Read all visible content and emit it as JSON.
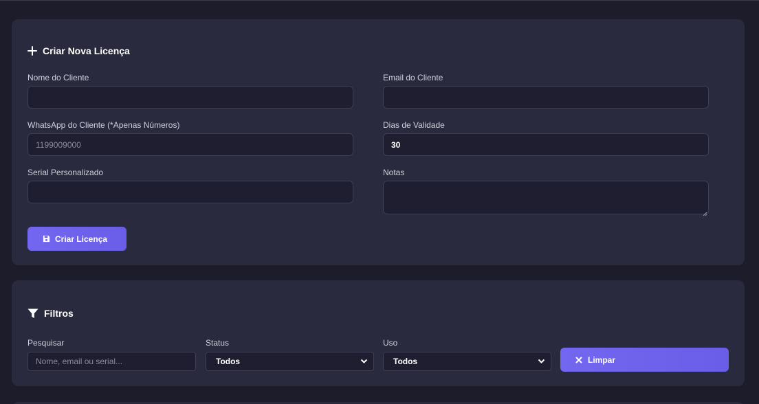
{
  "create": {
    "title": "Criar Nova Licença",
    "fields": {
      "name": {
        "label": "Nome do Cliente",
        "value": "",
        "placeholder": ""
      },
      "email": {
        "label": "Email do Cliente",
        "value": "",
        "placeholder": ""
      },
      "whatsapp": {
        "label": "WhatsApp do Cliente (*Apenas Números)",
        "value": "",
        "placeholder": "1199009000"
      },
      "days": {
        "label": "Dias de Validade",
        "value": "30",
        "placeholder": ""
      },
      "serial": {
        "label": "Serial Personalizado",
        "value": "",
        "placeholder": ""
      },
      "notes": {
        "label": "Notas",
        "value": "",
        "placeholder": ""
      }
    },
    "submit_label": "Criar Licença"
  },
  "filters": {
    "title": "Filtros",
    "search": {
      "label": "Pesquisar",
      "placeholder": "Nome, email ou serial..."
    },
    "status": {
      "label": "Status",
      "selected": "Todos"
    },
    "usage": {
      "label": "Uso",
      "selected": "Todos"
    },
    "clear_label": "Limpar"
  },
  "icons": {
    "create": "plus-icon",
    "submit": "floppy-disk-icon",
    "filters": "funnel-icon",
    "clear": "x-icon",
    "select": "chevron-down-icon"
  },
  "colors": {
    "background": "#1c1c2b",
    "card": "#2a2a3e",
    "input": "#1e1e30",
    "accent": "#7367f0"
  }
}
